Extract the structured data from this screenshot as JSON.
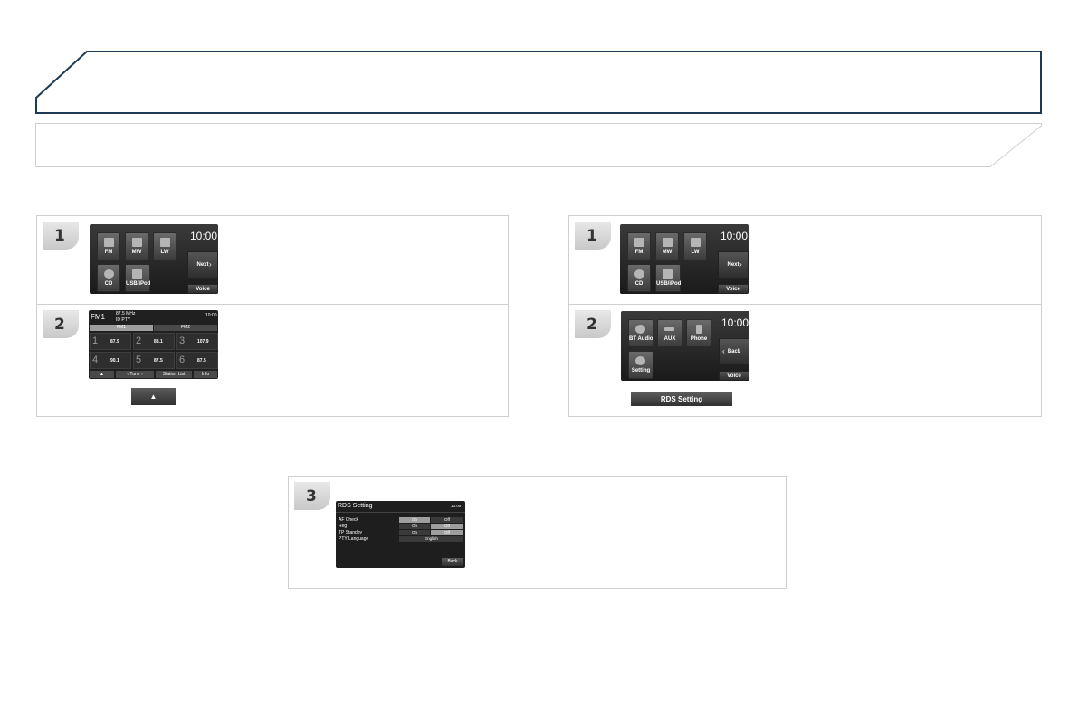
{
  "colors": {
    "title_border": "#1e3a55",
    "panel_border": "#cfcfcf",
    "screen_bg": "#222222"
  },
  "left": {
    "step1": {
      "badge": "1",
      "screen": {
        "clock": "10:00",
        "tiles": [
          "FM",
          "MW",
          "LW",
          "CD",
          "USB/iPod"
        ],
        "next": "Next",
        "voice": "Voice"
      }
    },
    "step2": {
      "badge": "2",
      "screen": {
        "band": "FM1",
        "freq": "87.5 MHz",
        "pty": "ID PTY",
        "clock": "10:00",
        "tab1": "FM1",
        "tab2": "FM2",
        "presets": [
          {
            "num": "1",
            "val": "87.9"
          },
          {
            "num": "2",
            "val": "88.1"
          },
          {
            "num": "3",
            "val": "107.9"
          },
          {
            "num": "4",
            "val": "90.1"
          },
          {
            "num": "5",
            "val": "87.5"
          },
          {
            "num": "6",
            "val": "87.5"
          }
        ],
        "bottom": [
          "▲",
          "‹  Tune  ›",
          "Station List",
          "Info"
        ]
      },
      "button": "▲"
    }
  },
  "right": {
    "step1": {
      "badge": "1",
      "screen": {
        "clock": "10:00",
        "tiles": [
          "FM",
          "MW",
          "LW",
          "CD",
          "USB/iPod"
        ],
        "next": "Next",
        "voice": "Voice"
      }
    },
    "step2": {
      "badge": "2",
      "screen": {
        "clock": "10:00",
        "tiles": [
          "BT Audio",
          "AUX",
          "Phone",
          "Setting"
        ],
        "back": "Back",
        "voice": "Voice"
      },
      "button": "RDS Setting"
    }
  },
  "step3": {
    "badge": "3",
    "screen": {
      "title": "RDS Setting",
      "clock": "10:00",
      "rows": [
        {
          "label": "AF Check",
          "a": "On",
          "b": "Off"
        },
        {
          "label": "Reg",
          "a": "On",
          "b": "Off"
        },
        {
          "label": "TP Standby",
          "a": "On",
          "b": "Off"
        }
      ],
      "pty_label": "PTY Language",
      "pty_value": "English",
      "back": "Back"
    }
  }
}
